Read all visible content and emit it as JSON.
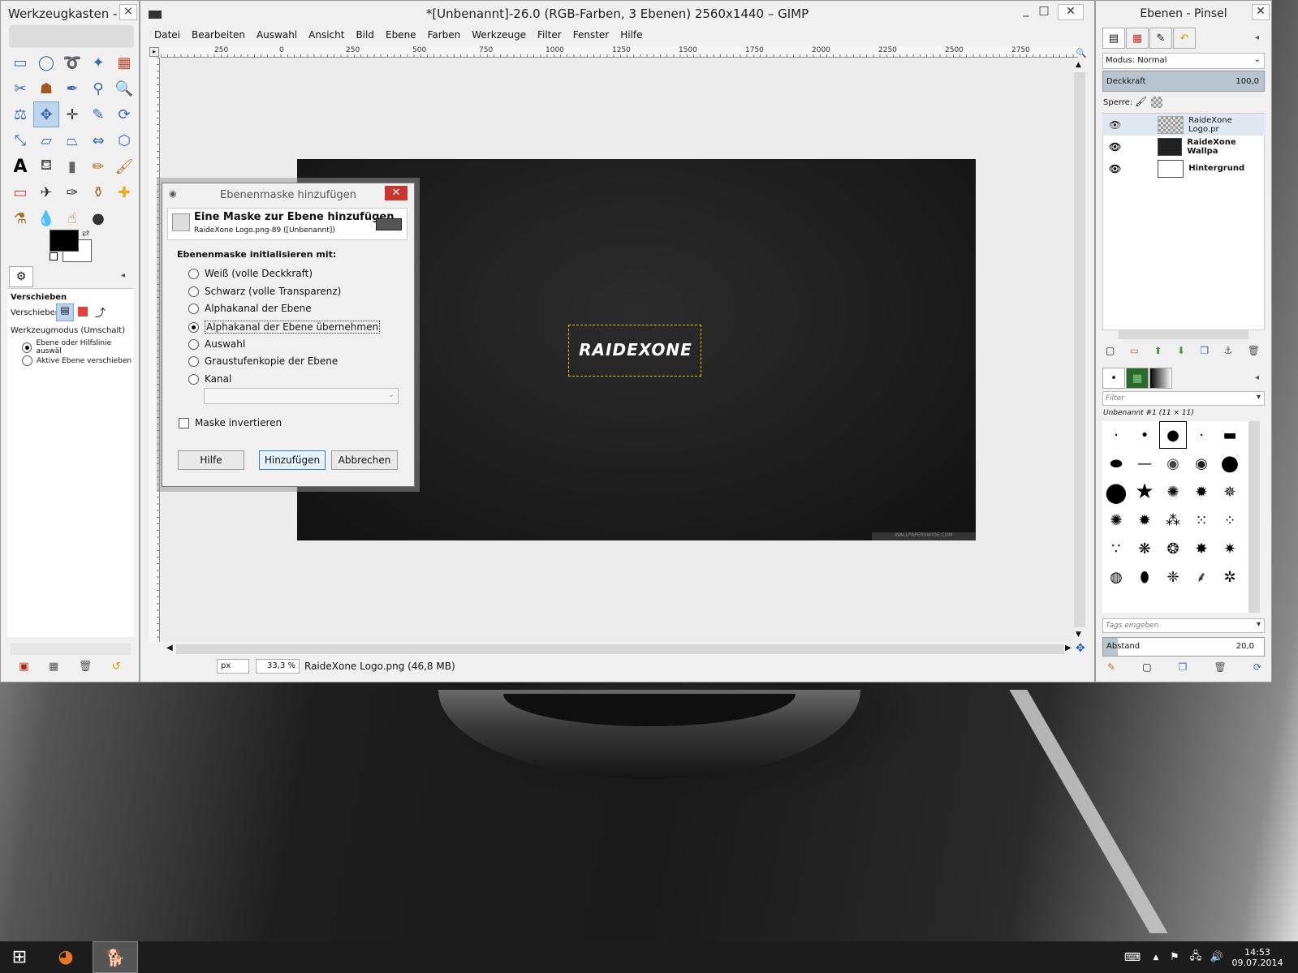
{
  "toolbox": {
    "title": "Werkzeugkasten - ...",
    "close": "×",
    "options_title": "Verschieben",
    "move_label": "Verschieben:",
    "tool_mode_label": "Werkzeugmodus (Umschalt)",
    "mode_option_1": "Ebene oder Hilfslinie auswäl",
    "mode_option_2": "Aktive Ebene verschieben"
  },
  "main": {
    "title": "*[Unbenannt]-26.0 (RGB-Farben, 3 Ebenen) 2560x1440 – GIMP",
    "minimize": "_",
    "maximize": "□",
    "close": "✕",
    "menus": [
      "Datei",
      "Bearbeiten",
      "Auswahl",
      "Ansicht",
      "Bild",
      "Ebene",
      "Farben",
      "Werkzeuge",
      "Filter",
      "Fenster",
      "Hilfe"
    ],
    "ruler_ticks": [
      "250",
      "0",
      "250",
      "500",
      "750",
      "1000",
      "1250",
      "1500",
      "1750",
      "2000",
      "2250",
      "2500",
      "2750"
    ],
    "logo_text": "RAIDEXONE",
    "watermark": "WALLPAPERSWIDE.COM",
    "unit": "px",
    "zoom": "33,3 %",
    "status": "RaideXone Logo.png (46,8 MB)"
  },
  "dialog": {
    "title": "Ebenenmaske hinzufügen",
    "close": "✕",
    "header": "Eine Maske zur Ebene hinzufügen",
    "subheader": "RaideXone Logo.png-89 ([Unbenannt])",
    "init_label": "Ebenenmaske initialisieren mit:",
    "options": [
      "Weiß (volle Deckkraft)",
      "Schwarz (volle Transparenz)",
      "Alphakanal der Ebene",
      "Alphakanal der Ebene übernehmen",
      "Auswahl",
      "Graustufenkopie der Ebene",
      "Kanal"
    ],
    "invert_label": "Maske invertieren",
    "help_button": "Hilfe",
    "add_button": "Hinzufügen",
    "cancel_button": "Abbrechen"
  },
  "layers_panel": {
    "title": "Ebenen - Pinsel",
    "mode": "Modus: Normal",
    "opacity_label": "Deckkraft",
    "opacity_value": "100,0",
    "lock_label": "Sperre:",
    "layers": [
      "RaideXone Logo.pr",
      "RaideXone Wallpa",
      "Hintergrund"
    ],
    "brush_filter": "Filter",
    "brush_name": "Unbenannt #1 (11 × 11)",
    "tags_placeholder": "Tags eingeben",
    "spacing_label": "Abstand",
    "spacing_value": "20,0"
  },
  "taskbar": {
    "time": "14:53",
    "date": "09.07.2014"
  }
}
